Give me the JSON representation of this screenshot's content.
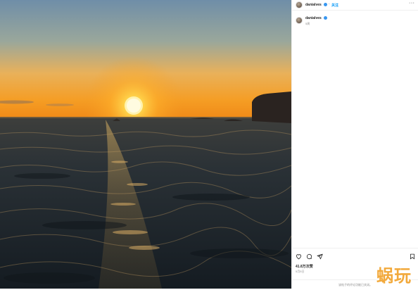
{
  "post": {
    "username": "danialves",
    "follow_label": "关注",
    "time_ago": "5周",
    "likes": "41.8万次赞",
    "date": "5月5日",
    "comment_note": "该帖子的评论功能已关闭。"
  },
  "icons": {
    "more": "more-options-icon",
    "like": "heart-icon",
    "comment": "comment-icon",
    "share": "share-icon",
    "save": "bookmark-icon"
  },
  "watermark": {
    "text": "蜗玩"
  },
  "colors": {
    "sky_top": "#6f8ea8",
    "sky_glow": "#f5a623",
    "sun": "#ffd24a",
    "sea": "#1f2b33",
    "verified": "#3897f0",
    "follow": "#0095f6",
    "watermark": "#f2a93b"
  }
}
